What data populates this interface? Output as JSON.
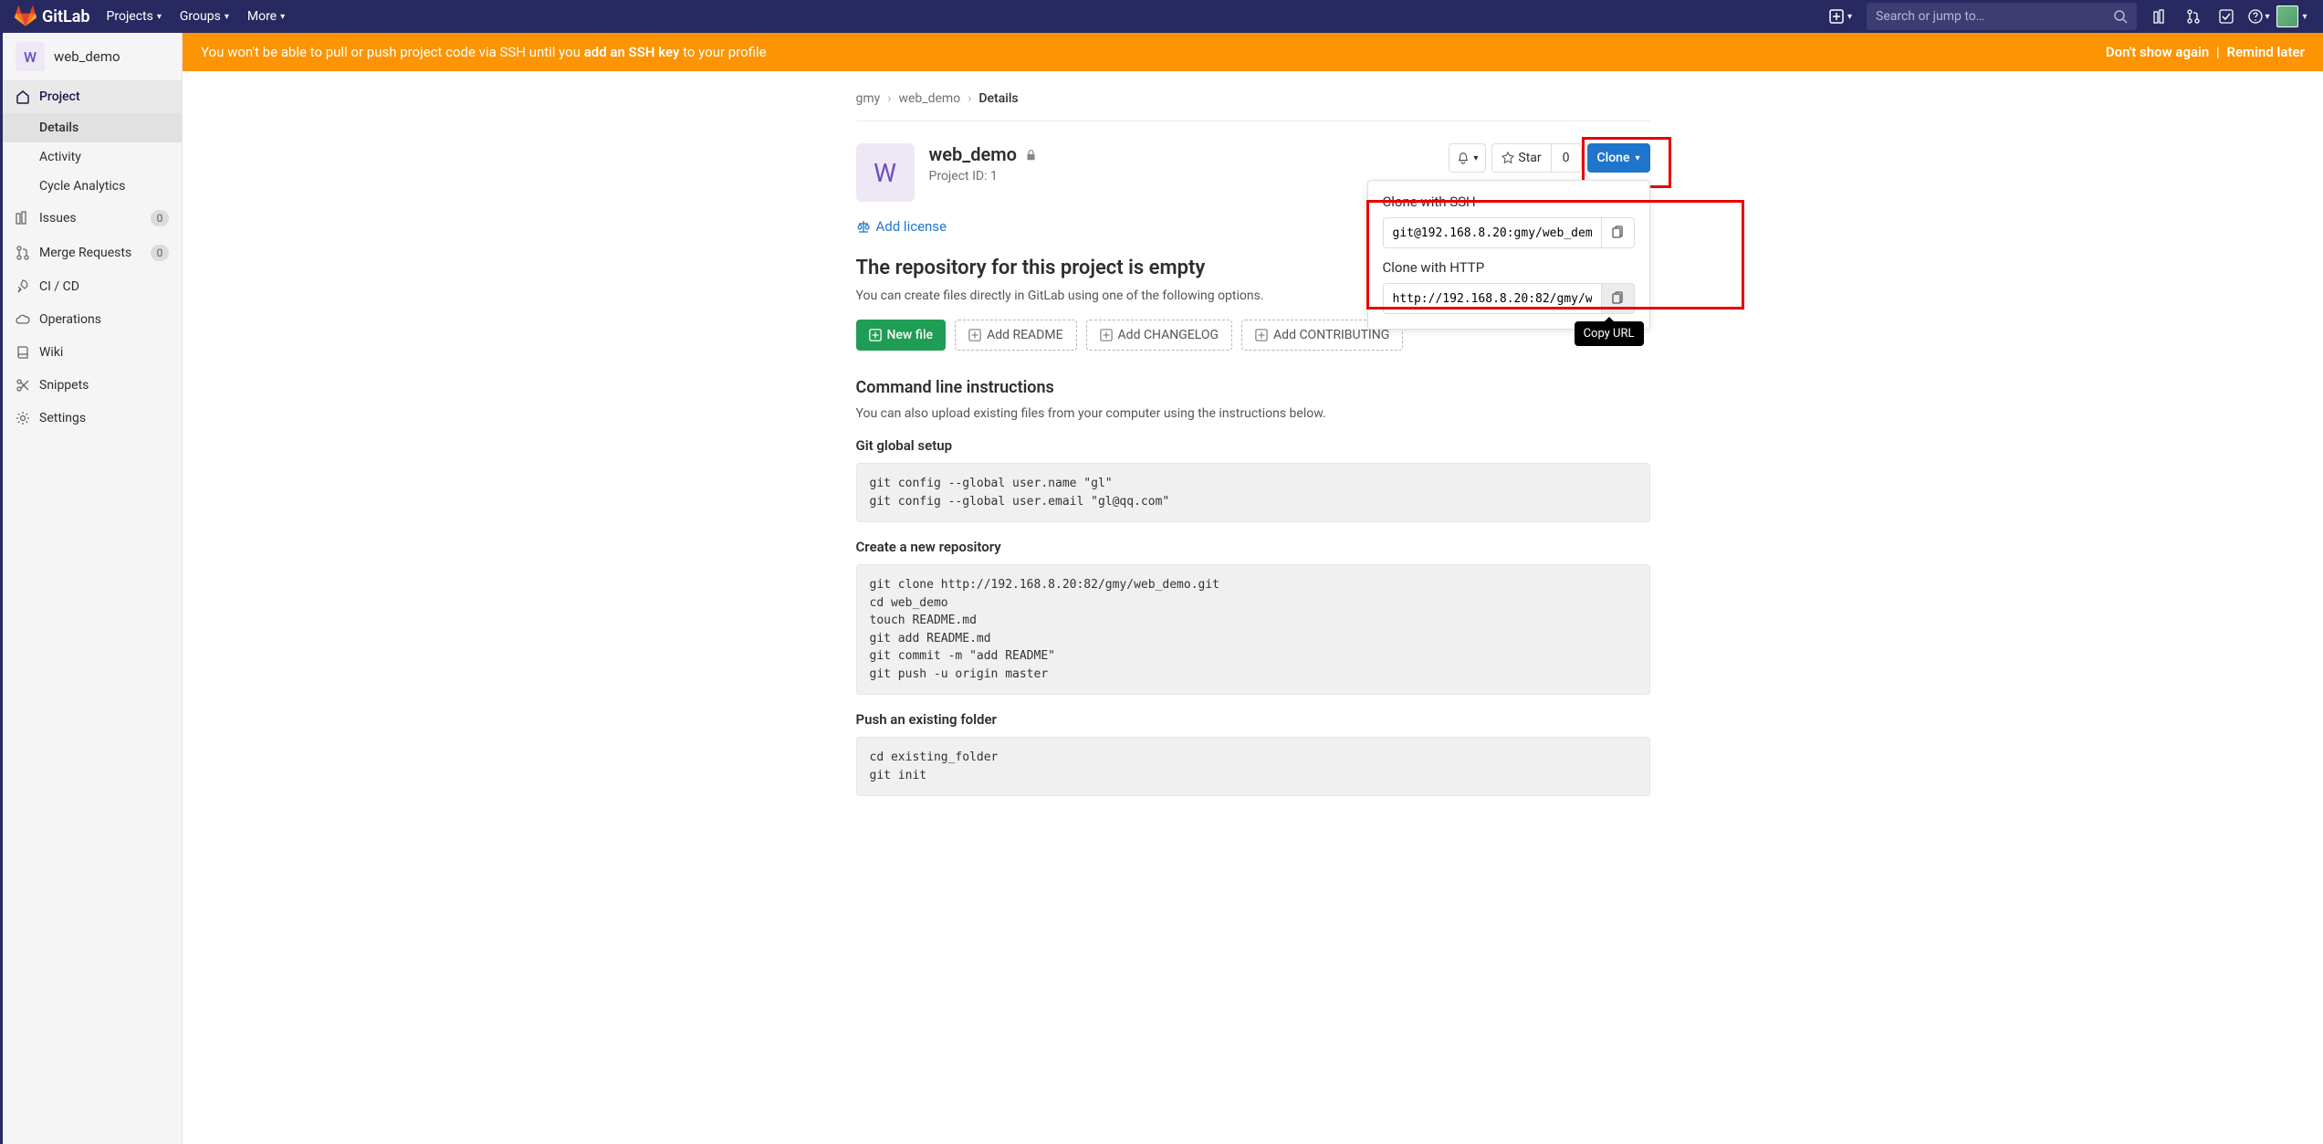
{
  "nav": {
    "brand": "GitLab",
    "items": [
      "Projects",
      "Groups",
      "More"
    ],
    "search_placeholder": "Search or jump to…"
  },
  "sidebar": {
    "context": {
      "avatar_letter": "W",
      "name": "web_demo"
    },
    "project_label": "Project",
    "subs": [
      "Details",
      "Activity",
      "Cycle Analytics"
    ],
    "active_sub": "Details",
    "rows": [
      {
        "label": "Issues",
        "badge": "0"
      },
      {
        "label": "Merge Requests",
        "badge": "0"
      },
      {
        "label": "CI / CD"
      },
      {
        "label": "Operations"
      },
      {
        "label": "Wiki"
      },
      {
        "label": "Snippets"
      },
      {
        "label": "Settings"
      }
    ]
  },
  "banner": {
    "prefix": "You won't be able to pull or push project code via SSH until you ",
    "link": "add an SSH key",
    "suffix": " to your profile",
    "dismiss": "Don't show again",
    "remind": "Remind later"
  },
  "crumbs": {
    "a": "gmy",
    "b": "web_demo",
    "c": "Details"
  },
  "project": {
    "avatar_letter": "W",
    "name": "web_demo",
    "id_label": "Project ID: 1",
    "star_label": "Star",
    "star_count": "0",
    "clone_label": "Clone"
  },
  "clone": {
    "ssh_label": "Clone with SSH",
    "ssh_url": "git@192.168.8.20:gmy/web_dem",
    "http_label": "Clone with HTTP",
    "http_url": "http://192.168.8.20:82/gmy/w",
    "tooltip": "Copy URL"
  },
  "addlicense": "Add license",
  "empty": {
    "title": "The repository for this project is empty",
    "sub": "You can create files directly in GitLab using one of the following options.",
    "newfile": "New file",
    "readme": "Add README",
    "changelog": "Add CHANGELOG",
    "contrib": "Add CONTRIBUTING"
  },
  "cli": {
    "title": "Command line instructions",
    "upload": "You can also upload existing files from your computer using the instructions below.",
    "setup_h": "Git global setup",
    "setup_code": "git config --global user.name \"gl\"\ngit config --global user.email \"gl@qq.com\"",
    "create_h": "Create a new repository",
    "create_code": "git clone http://192.168.8.20:82/gmy/web_demo.git\ncd web_demo\ntouch README.md\ngit add README.md\ngit commit -m \"add README\"\ngit push -u origin master",
    "push_h": "Push an existing folder",
    "push_code": "cd existing_folder\ngit init"
  }
}
